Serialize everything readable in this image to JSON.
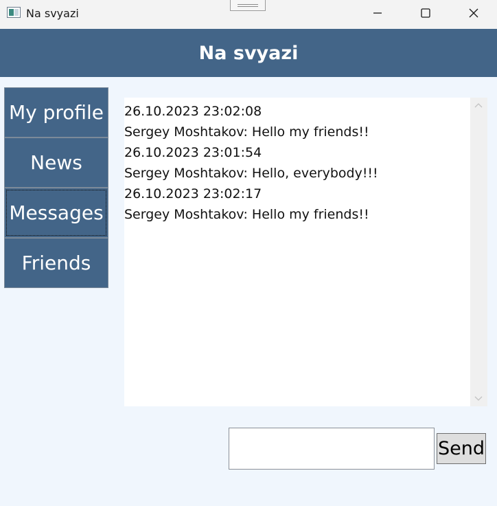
{
  "window": {
    "title": "Na svyazi"
  },
  "header": {
    "title": "Na svyazi",
    "background": "#436588"
  },
  "nav": {
    "items": [
      {
        "label": "My profile"
      },
      {
        "label": "News"
      },
      {
        "label": "Messages",
        "focused": true
      },
      {
        "label": "Friends"
      }
    ]
  },
  "messages": [
    {
      "timestamp": "26.10.2023 23:02:08",
      "text": "Sergey Moshtakov: Hello my friends!!"
    },
    {
      "timestamp": "26.10.2023 23:01:54",
      "text": "Sergey Moshtakov: Hello, everybody!!!"
    },
    {
      "timestamp": "26.10.2023 23:02:17",
      "text": "Sergey Moshtakov: Hello my friends!!"
    }
  ],
  "composer": {
    "value": "",
    "send_label": "Send"
  },
  "icons": {
    "minimize": "minimize-icon",
    "maximize": "maximize-icon",
    "close": "close-icon",
    "scroll_up": "chevron-up-icon",
    "scroll_down": "chevron-down-icon"
  }
}
